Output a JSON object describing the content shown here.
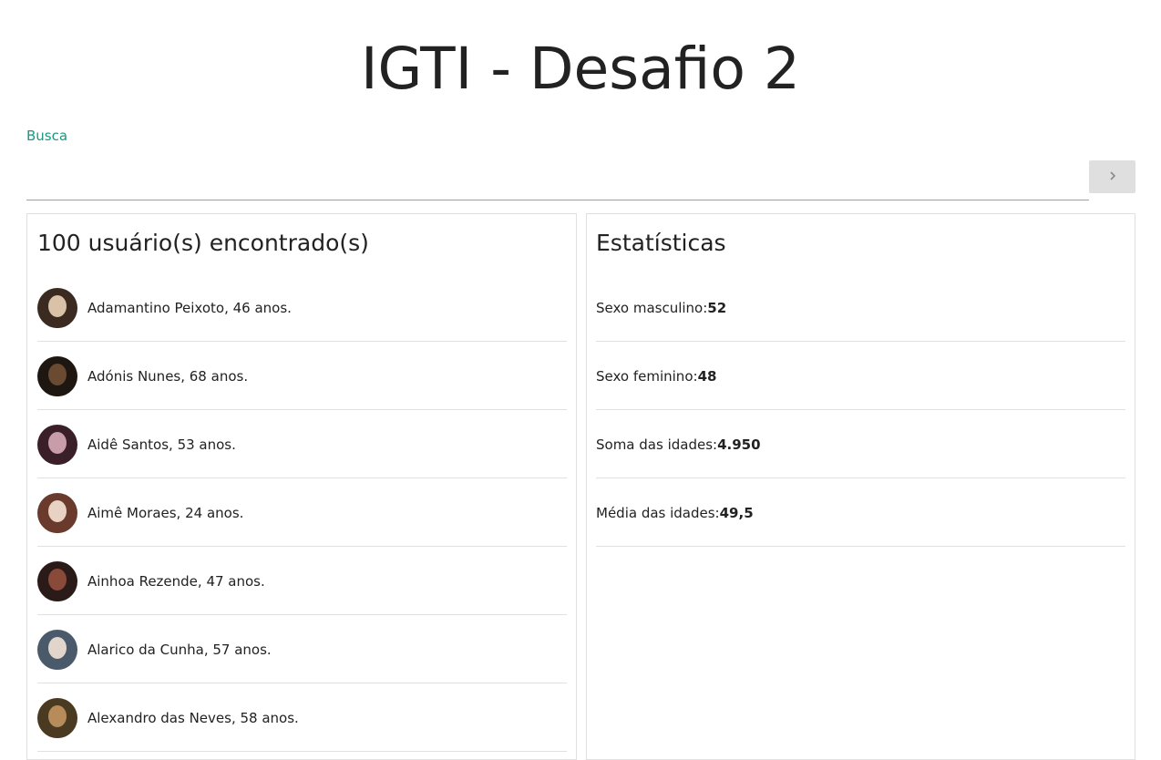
{
  "header": {
    "title": "IGTI - Desafio 2"
  },
  "search": {
    "label": "Busca",
    "value": "",
    "button_icon": "chevron-right-icon"
  },
  "users_panel": {
    "heading": "100 usuário(s) encontrado(s)",
    "users": [
      {
        "text": "Adamantino Peixoto, 46 anos.",
        "avatar_colors": [
          "#d9c2a8",
          "#3a2a20"
        ]
      },
      {
        "text": "Adónis Nunes, 68 anos.",
        "avatar_colors": [
          "#6a4a30",
          "#1e1610"
        ]
      },
      {
        "text": "Aidê Santos, 53 anos.",
        "avatar_colors": [
          "#c89ca8",
          "#3a1e28"
        ]
      },
      {
        "text": "Aimê Moraes, 24 anos.",
        "avatar_colors": [
          "#e8d2c4",
          "#6a3a2c"
        ]
      },
      {
        "text": "Ainhoa Rezende, 47 anos.",
        "avatar_colors": [
          "#8a4a3a",
          "#2a1a18"
        ]
      },
      {
        "text": "Alarico da Cunha, 57 anos.",
        "avatar_colors": [
          "#e2d6cc",
          "#4a5a6a"
        ]
      },
      {
        "text": "Alexandro das Neves, 58 anos.",
        "avatar_colors": [
          "#b88c5a",
          "#4a3a22"
        ]
      }
    ]
  },
  "stats_panel": {
    "heading": "Estatísticas",
    "items": [
      {
        "label": "Sexo masculino:",
        "value": "52"
      },
      {
        "label": "Sexo feminino:",
        "value": "48"
      },
      {
        "label": "Soma das idades:",
        "value": "4.950"
      },
      {
        "label": "Média das idades:",
        "value": "49,5"
      }
    ]
  },
  "colors": {
    "accent": "#1a9880",
    "button_bg": "#dfdfdf",
    "divider": "#e0e0e0",
    "text": "#222222"
  }
}
